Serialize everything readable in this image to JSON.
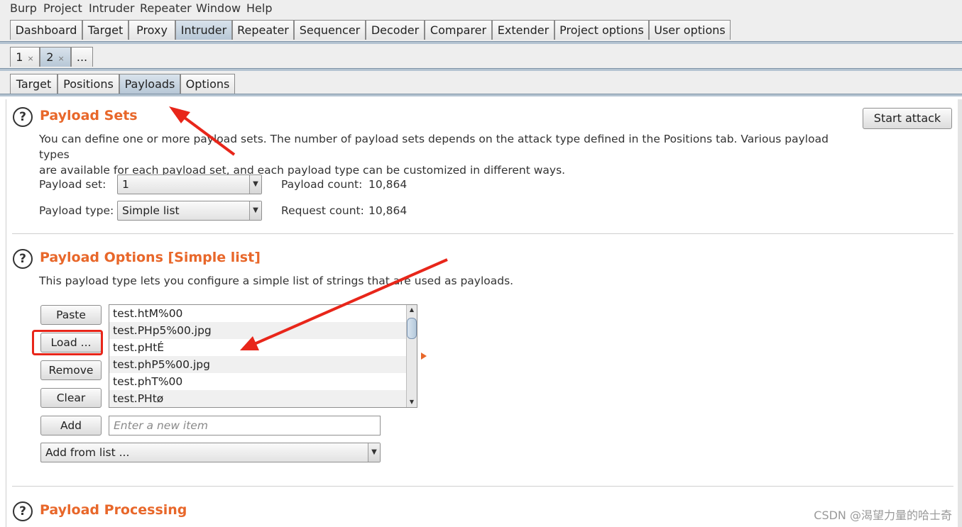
{
  "menu": [
    "Burp",
    "Project",
    "Intruder",
    "Repeater",
    "Window",
    "Help"
  ],
  "main_tabs": [
    "Dashboard",
    "Target",
    "Proxy",
    "Intruder",
    "Repeater",
    "Sequencer",
    "Decoder",
    "Comparer",
    "Extender",
    "Project options",
    "User options"
  ],
  "attack_tabs": {
    "t1": "1",
    "t2": "2",
    "close": "×",
    "more": "..."
  },
  "sub_tabs": [
    "Target",
    "Positions",
    "Payloads",
    "Options"
  ],
  "payload_sets": {
    "title": "Payload Sets",
    "desc_line1": "You can define one or more payload sets. The number of payload sets depends on the attack type defined in the Positions tab. Various payload types",
    "desc_line2": "are available for each payload set, and each payload type can be customized in different ways.",
    "set_label": "Payload set:",
    "set_value": "1",
    "type_label": "Payload type:",
    "type_value": "Simple list",
    "count_label": "Payload count:",
    "count_value": "10,864",
    "request_label": "Request count:",
    "request_value": "10,864",
    "start_attack": "Start attack"
  },
  "payload_options": {
    "title": "Payload Options [Simple list]",
    "desc": "This payload type lets you configure a simple list of strings that are used as payloads.",
    "buttons": {
      "paste": "Paste",
      "load": "Load ...",
      "remove": "Remove",
      "clear": "Clear",
      "add": "Add"
    },
    "items": [
      "test.htM%00",
      "test.PHp5%00.jpg",
      "test.pHtÉ",
      "test.phP5%00.jpg",
      "test.phT%00",
      "test.PHtø"
    ],
    "add_placeholder": "Enter a new item",
    "add_from_list": "Add from list ..."
  },
  "payload_processing": {
    "title": "Payload Processing"
  },
  "icons": {
    "help": "?",
    "dropdown": "▼",
    "scroll_up": "▲",
    "scroll_down": "▼"
  },
  "watermark": "CSDN @渴望力量的哈士奇",
  "colors": {
    "accent_title": "#e8672a",
    "selected_tab": "#b7c7d6",
    "annotation": "#e8261a"
  }
}
